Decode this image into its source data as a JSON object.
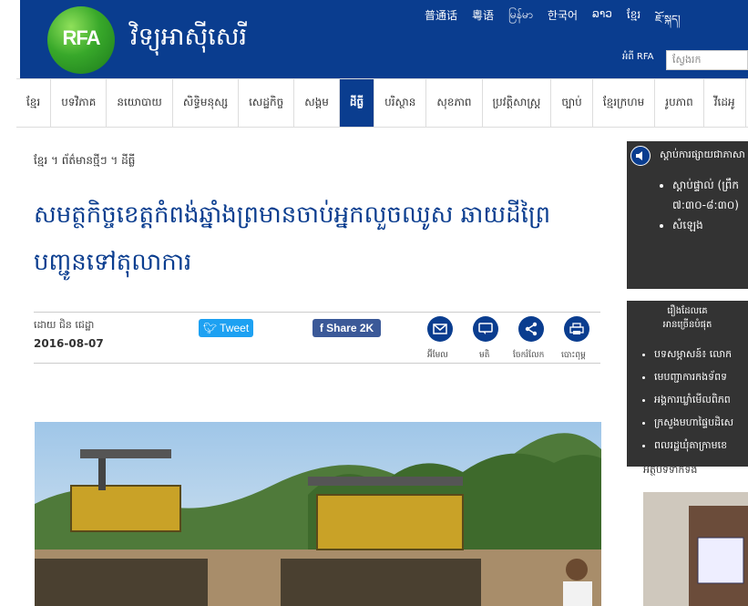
{
  "header": {
    "logo_text": "RFA",
    "site_name": "វិទ្យុអាស៊ីសេរី",
    "languages": [
      "普通话",
      "粵语",
      "မြန်မာ",
      "한국어",
      "ລາວ",
      "ខ្មែរ",
      "ཇོ་སྐད།"
    ],
    "about_label": "អំពី RFA",
    "search_placeholder": "ស្វែងរក"
  },
  "nav": {
    "items": [
      "ខ្មែរ",
      "បទវិភាគ",
      "នយោបាយ",
      "សិទ្ធិមនុស្ស",
      "សេដ្ឋកិច្ច",
      "សង្គម",
      "ដីធ្លី",
      "បរិស្ថាន",
      "សុខភាព",
      "ប្រវត្តិសាស្ត្រ",
      "ច្បាប់",
      "ខ្មែរក្រហម",
      "រូបភាព",
      "វីដេអូ",
      "ម៉"
    ],
    "active_index": 6
  },
  "article": {
    "breadcrumb": "ខ្មែរ ។ ព័ត៌មានថ្មីៗ ។ ដីធ្លី",
    "headline": "សមត្ថកិច្ចខេត្តកំពង់ឆ្នាំងព្រមានចាប់អ្នកលួចឈូស ឆាយដីព្រៃបញ្ជូនទៅតុលាការ",
    "byline": "ដោយ ជិន ជេដ្ឋា",
    "date": "2016-08-07",
    "tweet_label": "Tweet",
    "share_label": "Share 2K",
    "tools": [
      "អ៊ីមែល",
      "មតិ",
      "ចែករំលែក",
      "បោះពុម្ព"
    ]
  },
  "sidebar": {
    "listen_title": "ស្ដាប់ការផ្សាយជាភាសា",
    "listen_items": [
      "ស្ដាប់ផ្ទាល់ (ព្រឹក",
      "៧:៣០-៨:៣០)",
      "សំឡេង"
    ],
    "popular_title_1": "រឿងដែលគេ",
    "popular_title_2": "អានច្រើនបំផុត",
    "popular_items": [
      "បទសម្ភាសន៍៖ លោក",
      "មេបញ្ជាការកងទ័ពទ",
      "អង្គការឃ្លាំមើលពិភព",
      "ក្រសួងមហាផ្ទៃបដិសេ",
      "ពលរដ្ឋឃុំតាក្រាមខេ"
    ],
    "recommended_title": "អត្ថបទទាក់ទង"
  },
  "colors": {
    "brand_blue": "#0a3d8f",
    "tweet_blue": "#1da1f2",
    "facebook_blue": "#3b5998",
    "sidebar_dark": "#333333"
  }
}
